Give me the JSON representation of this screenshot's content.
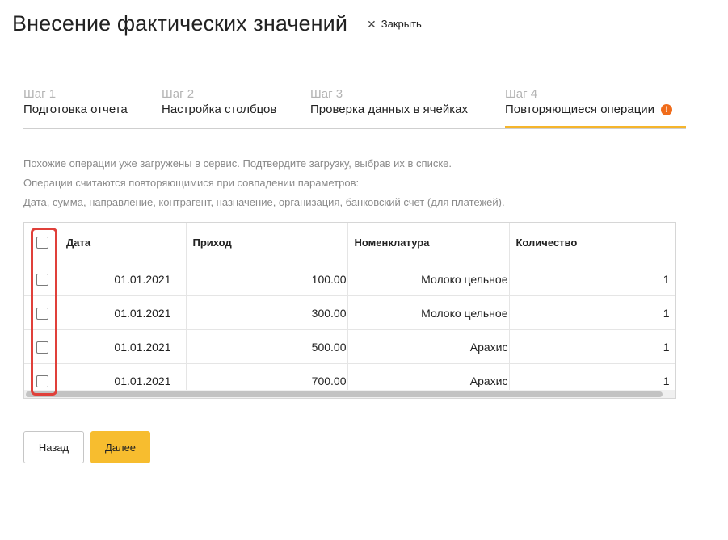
{
  "header": {
    "title": "Внесение фактических значений",
    "close_label": "Закрыть"
  },
  "steps": [
    {
      "num": "Шаг 1",
      "name": "Подготовка отчета",
      "active": false
    },
    {
      "num": "Шаг 2",
      "name": "Настройка столбцов",
      "active": false
    },
    {
      "num": "Шаг 3",
      "name": "Проверка данных в ячейках",
      "active": false
    },
    {
      "num": "Шаг 4",
      "name": "Повторяющиеся операции",
      "active": true,
      "warning": "!"
    }
  ],
  "info": {
    "line1": "Похожие операции уже загружены в сервис. Подтвердите загрузку, выбрав их в списке.",
    "line2": "Операции считаются повторяющимися при совпадении параметров:",
    "line3": "Дата, сумма, направление, контрагент, назначение, организация, банковский счет (для платежей)."
  },
  "table": {
    "columns": [
      "Дата",
      "Приход",
      "Номенклатура",
      "Количество"
    ],
    "rows": [
      {
        "date": "01.01.2021",
        "income": "100.00",
        "item": "Молоко цельное",
        "qty": "1",
        "checked": false
      },
      {
        "date": "01.01.2021",
        "income": "300.00",
        "item": "Молоко цельное",
        "qty": "1",
        "checked": false
      },
      {
        "date": "01.01.2021",
        "income": "500.00",
        "item": "Арахис",
        "qty": "1",
        "checked": false
      },
      {
        "date": "01.01.2021",
        "income": "700.00",
        "item": "Арахис",
        "qty": "1",
        "checked": false
      }
    ]
  },
  "buttons": {
    "back": "Назад",
    "next": "Далее"
  },
  "colors": {
    "accent": "#f7bd2f",
    "warning": "#f06c1b",
    "highlight": "#e0403a"
  }
}
